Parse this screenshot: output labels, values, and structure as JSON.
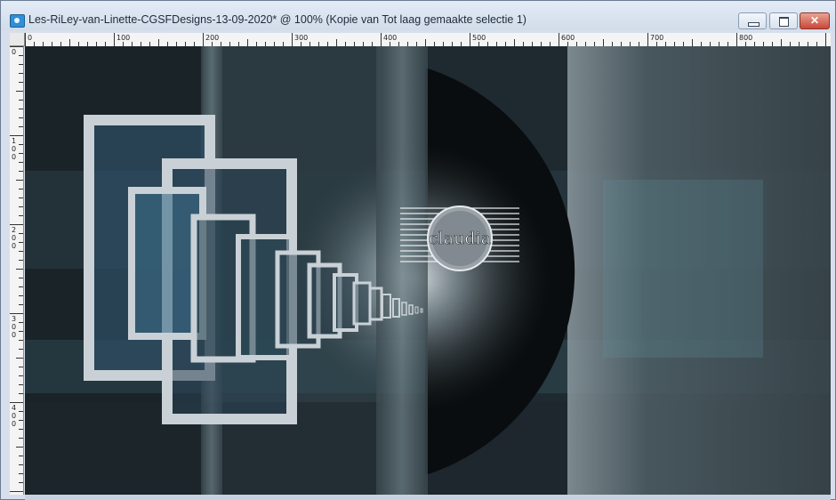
{
  "window": {
    "title": "Les-RiLey-van-Linette-CGSFDesigns-13-09-2020* @ 100% (Kopie van Tot laag gemaakte selectie 1)",
    "minimize_label": "",
    "maximize_label": "",
    "close_label": "✕"
  },
  "ruler": {
    "horizontal_labels": [
      "0",
      "100",
      "200",
      "300",
      "400",
      "500",
      "600",
      "700",
      "800"
    ],
    "vertical_labels": [
      "0",
      "100",
      "200",
      "300",
      "400"
    ]
  },
  "canvas": {
    "watermark_text": "claudia",
    "accent_color": "#5f8f9a",
    "background_color": "#243138"
  },
  "icons": {
    "app": "psp-app-icon",
    "minimize": "minimize-icon",
    "maximize": "maximize-icon",
    "close": "close-icon"
  }
}
